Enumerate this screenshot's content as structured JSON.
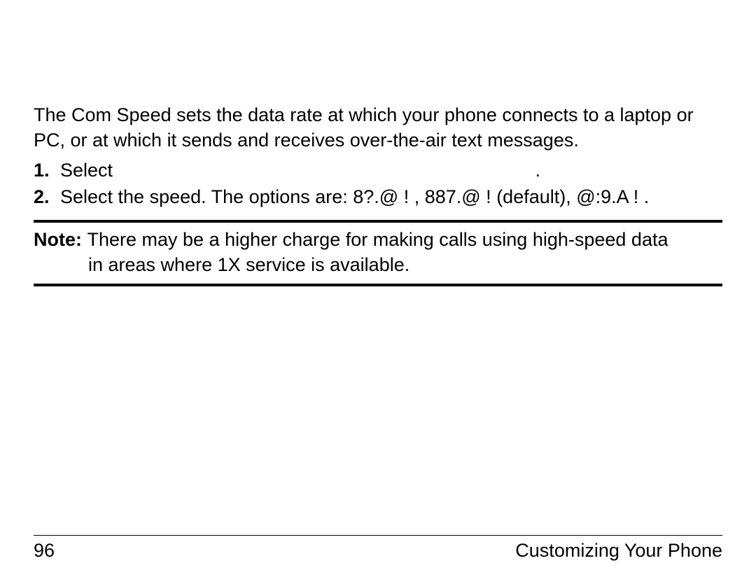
{
  "intro": "The Com Speed sets the data rate at which your phone connects to a laptop or PC, or at which it sends and receives over-the-air text messages.",
  "steps": {
    "s1": {
      "num": "1.",
      "select": "Select",
      "dot": "."
    },
    "s2": {
      "num": "2.",
      "text": "Select the speed. The options are: 8?.@ !  , 887.@ !   (default), @:9.A !   ."
    }
  },
  "note": {
    "label": "Note: ",
    "line1": "There may be a higher charge for making calls using high-speed data",
    "line2": "in areas where 1X service is available."
  },
  "footer": {
    "page": "96",
    "section": "Customizing Your Phone"
  }
}
